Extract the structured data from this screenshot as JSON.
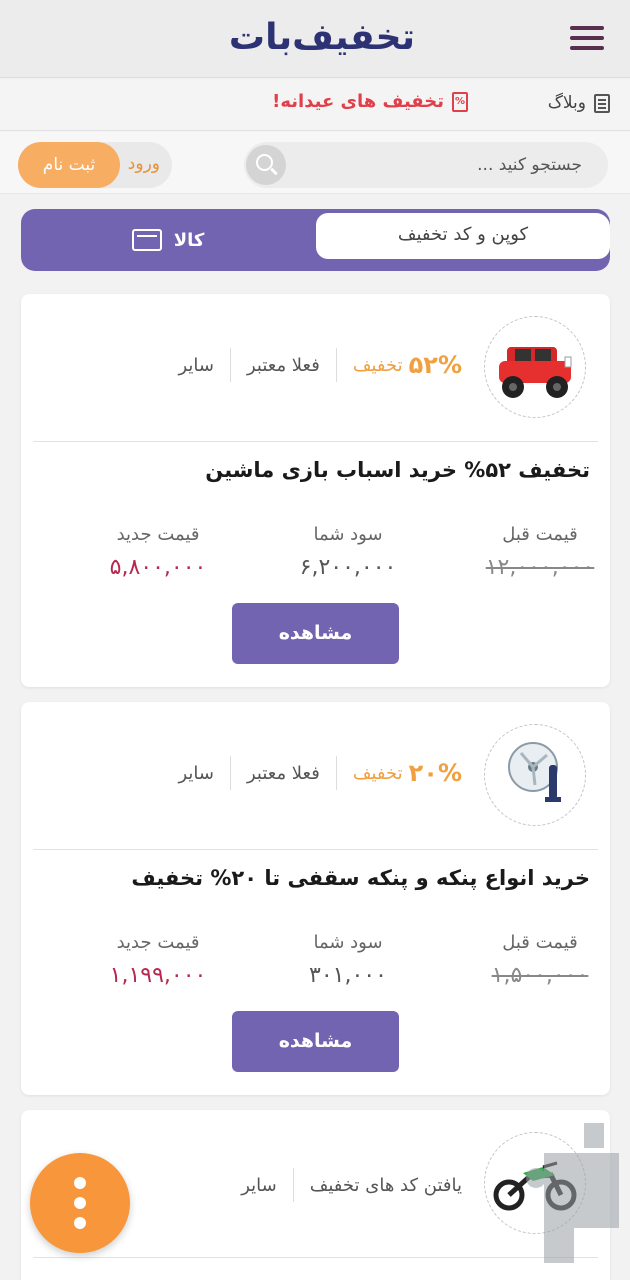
{
  "header": {
    "logo_text": "تخفیف‌بات",
    "menu_icon": "hamburger-menu-icon"
  },
  "subnav": {
    "blog_label": "وبلاگ",
    "eid_label": "تخفیف های عیدانه!",
    "eid_color": "#e0404a"
  },
  "search": {
    "placeholder": "جستجو کنید ..."
  },
  "auth": {
    "login_label": "ورود",
    "signup_label": "ثبت نام"
  },
  "tabs": {
    "coupon_label": "کوپن و کد تخفیف",
    "goods_label": "کالا",
    "active": "goods"
  },
  "cards": [
    {
      "discount_pct": "۵۲%",
      "discount_label": "تخفیف",
      "status": "فعلا معتبر",
      "category": "سایر",
      "title": "تخفیف ۵۲% خرید اسباب بازی ماشین",
      "old_price_label": "قیمت قبل",
      "old_price": "۱۲,۰۰۰,۰۰۰",
      "saving_label": "سود شما",
      "saving": "۶,۲۰۰,۰۰۰",
      "new_price_label": "قیمت جدید",
      "new_price": "۵,۸۰۰,۰۰۰",
      "button_label": "مشاهده",
      "image": "toy-car"
    },
    {
      "discount_pct": "۲۰%",
      "discount_label": "تخفیف",
      "status": "فعلا معتبر",
      "category": "سایر",
      "title": "خرید انواع پنکه و پنکه سقفی تا ۲۰% تخفیف",
      "old_price_label": "قیمت قبل",
      "old_price": "۱,۵۰۰,۰۰۰",
      "saving_label": "سود شما",
      "saving": "۳۰۱,۰۰۰",
      "new_price_label": "قیمت جدید",
      "new_price": "۱,۱۹۹,۰۰۰",
      "button_label": "مشاهده",
      "image": "wall-fan"
    },
    {
      "status": "یافتن کد های تخفیف",
      "category": "سایر",
      "image": "motorcycle"
    }
  ],
  "colors": {
    "primary": "#7264b0",
    "accent": "#f7963a",
    "new_price": "#b8284e"
  }
}
